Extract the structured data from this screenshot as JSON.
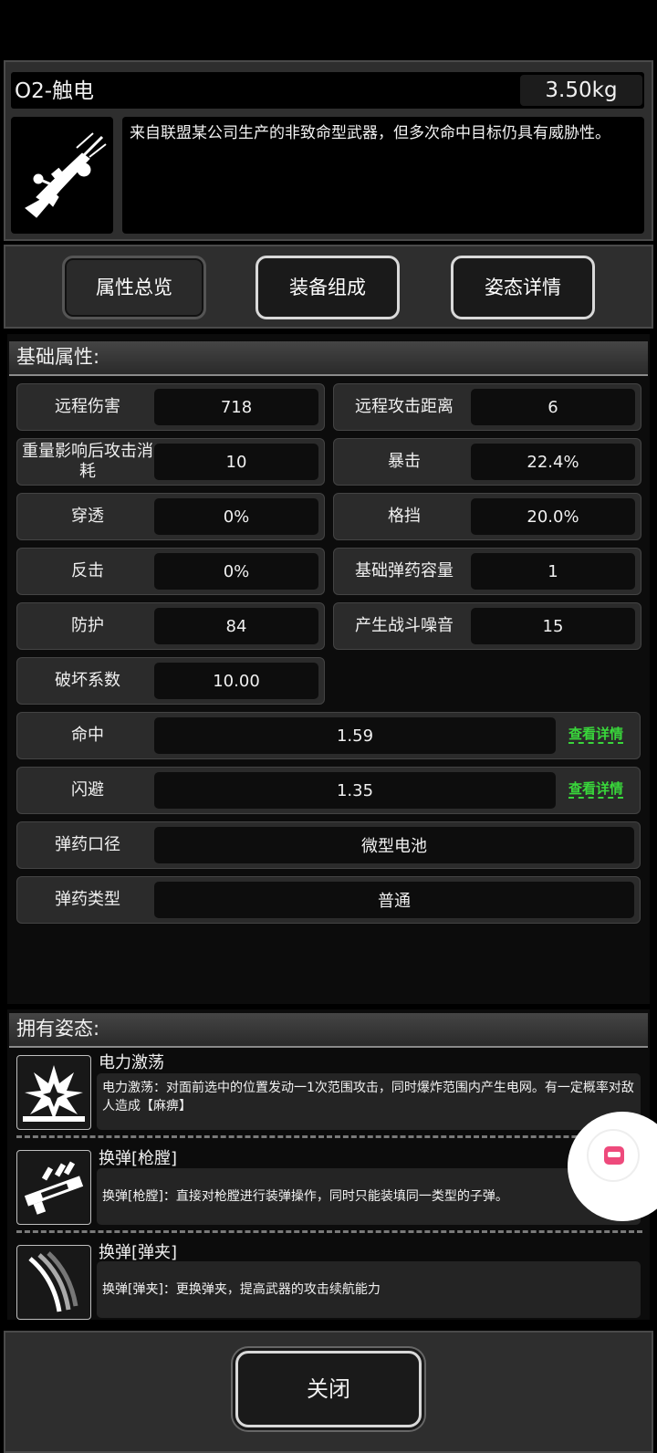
{
  "weapon": {
    "name": "O2-触电",
    "weight": "3.50kg",
    "description": "来自联盟某公司生产的非致命型武器，但多次命中目标仍具有威胁性。",
    "icon": "rifle-icon"
  },
  "tabs": [
    {
      "label": "属性总览",
      "active": true
    },
    {
      "label": "装备组成",
      "active": false
    },
    {
      "label": "姿态详情",
      "active": false
    }
  ],
  "basic": {
    "header": "基础属性:",
    "stats": [
      {
        "label": "远程伤害",
        "value": "718"
      },
      {
        "label": "远程攻击距离",
        "value": "6"
      },
      {
        "label": "重量影响后攻击消耗",
        "value": "10"
      },
      {
        "label": "暴击",
        "value": "22.4%"
      },
      {
        "label": "穿透",
        "value": "0%"
      },
      {
        "label": "格挡",
        "value": "20.0%"
      },
      {
        "label": "反击",
        "value": "0%"
      },
      {
        "label": "基础弹药容量",
        "value": "1"
      },
      {
        "label": "防护",
        "value": "84"
      },
      {
        "label": "产生战斗噪音",
        "value": "15"
      },
      {
        "label": "破坏系数",
        "value": "10.00"
      }
    ],
    "wide": [
      {
        "label": "命中",
        "value": "1.59",
        "link": "查看详情"
      },
      {
        "label": "闪避",
        "value": "1.35",
        "link": "查看详情"
      },
      {
        "label": "弹药口径",
        "value": "微型电池"
      },
      {
        "label": "弹药类型",
        "value": "普通"
      }
    ]
  },
  "stances": {
    "header": "拥有姿态:",
    "items": [
      {
        "name": "电力激荡",
        "desc": "电力激荡：对面前选中的位置发动一1次范围攻击，同时爆炸范围内产生电网。有一定概率对敌人造成【麻痹】",
        "icon": "explosion-icon"
      },
      {
        "name": "换弹[枪膛]",
        "desc": "换弹[枪膛]：直接对枪膛进行装弹操作，同时只能装填同一类型的子弹。",
        "icon": "chamber-reload-icon"
      },
      {
        "name": "换弹[弹夹]",
        "desc": "换弹[弹夹]：更换弹夹，提高武器的攻击续航能力",
        "icon": "magazine-icon"
      }
    ]
  },
  "close_label": "关闭"
}
